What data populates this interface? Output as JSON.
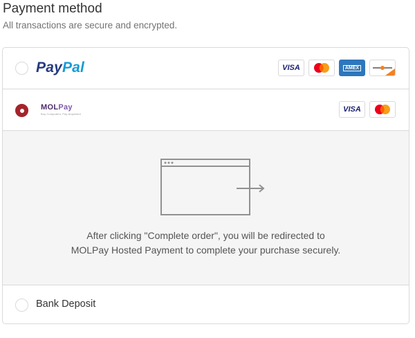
{
  "header": {
    "title": "Payment method",
    "subtitle": "All transactions are secure and encrypted."
  },
  "methods": [
    {
      "id": "paypal",
      "logo_text_1": "Pay",
      "logo_text_2": "Pal",
      "selected": false,
      "cards": [
        "VISA",
        "mastercard",
        "AMEX",
        "discover"
      ]
    },
    {
      "id": "molpay",
      "logo_text_1": "MOL",
      "logo_text_2": "Pay",
      "tagline": "Buy Computers, Pay Anywhere",
      "selected": true,
      "cards": [
        "VISA",
        "mastercard"
      ]
    },
    {
      "id": "bank_deposit",
      "label": "Bank Deposit",
      "selected": false
    }
  ],
  "redirect": {
    "line1": "After clicking \"Complete order\", you will be redirected to",
    "line2": "MOLPay Hosted Payment to complete your purchase securely.",
    "icon": "browser-redirect-icon"
  },
  "cards": {
    "visa": "VISA",
    "amex": "AMEX"
  },
  "colors": {
    "selected_radio": "#a5242b",
    "paypal_dark": "#253b80",
    "paypal_light": "#179bd7",
    "amex_blue": "#2e77bc",
    "info_bg": "#f5f5f5",
    "border": "#d9d9d9"
  }
}
